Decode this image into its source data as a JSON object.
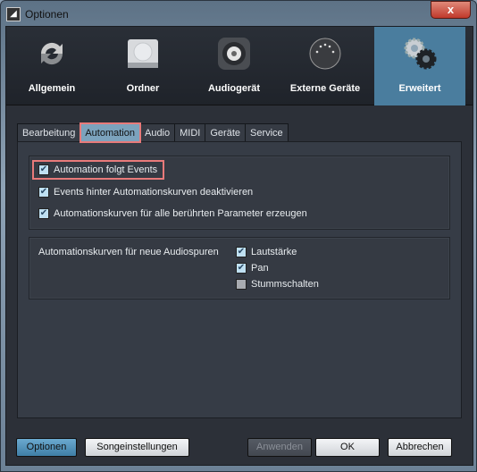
{
  "window": {
    "title": "Optionen",
    "close": "x"
  },
  "categories": [
    {
      "label": "Allgemein",
      "icon": "refresh-icon"
    },
    {
      "label": "Ordner",
      "icon": "drive-icon"
    },
    {
      "label": "Audiogerät",
      "icon": "speaker-icon"
    },
    {
      "label": "Externe Geräte",
      "icon": "midi-port-icon"
    },
    {
      "label": "Erweitert",
      "icon": "gears-icon",
      "selected": true
    }
  ],
  "tabs": [
    "Bearbeitung",
    "Automation",
    "Audio",
    "MIDI",
    "Geräte",
    "Service"
  ],
  "active_tab": "Automation",
  "group1": [
    {
      "label": "Automation folgt Events",
      "checked": true
    },
    {
      "label": "Events hinter Automationskurven deaktivieren",
      "checked": true
    },
    {
      "label": "Automationskurven für alle berührten Parameter erzeugen",
      "checked": true
    }
  ],
  "group2": {
    "label": "Automationskurven für neue Audiospuren",
    "options": [
      {
        "label": "Lautstärke",
        "checked": true
      },
      {
        "label": "Pan",
        "checked": true
      },
      {
        "label": "Stummschalten",
        "checked": false
      }
    ]
  },
  "buttons": {
    "optionen": "Optionen",
    "song": "Songeinstellungen",
    "apply": "Anwenden",
    "ok": "OK",
    "cancel": "Abbrechen"
  },
  "check_mark": "✔",
  "colors": {
    "selected": "#4a7d9e",
    "highlight": "#e87a7a"
  }
}
